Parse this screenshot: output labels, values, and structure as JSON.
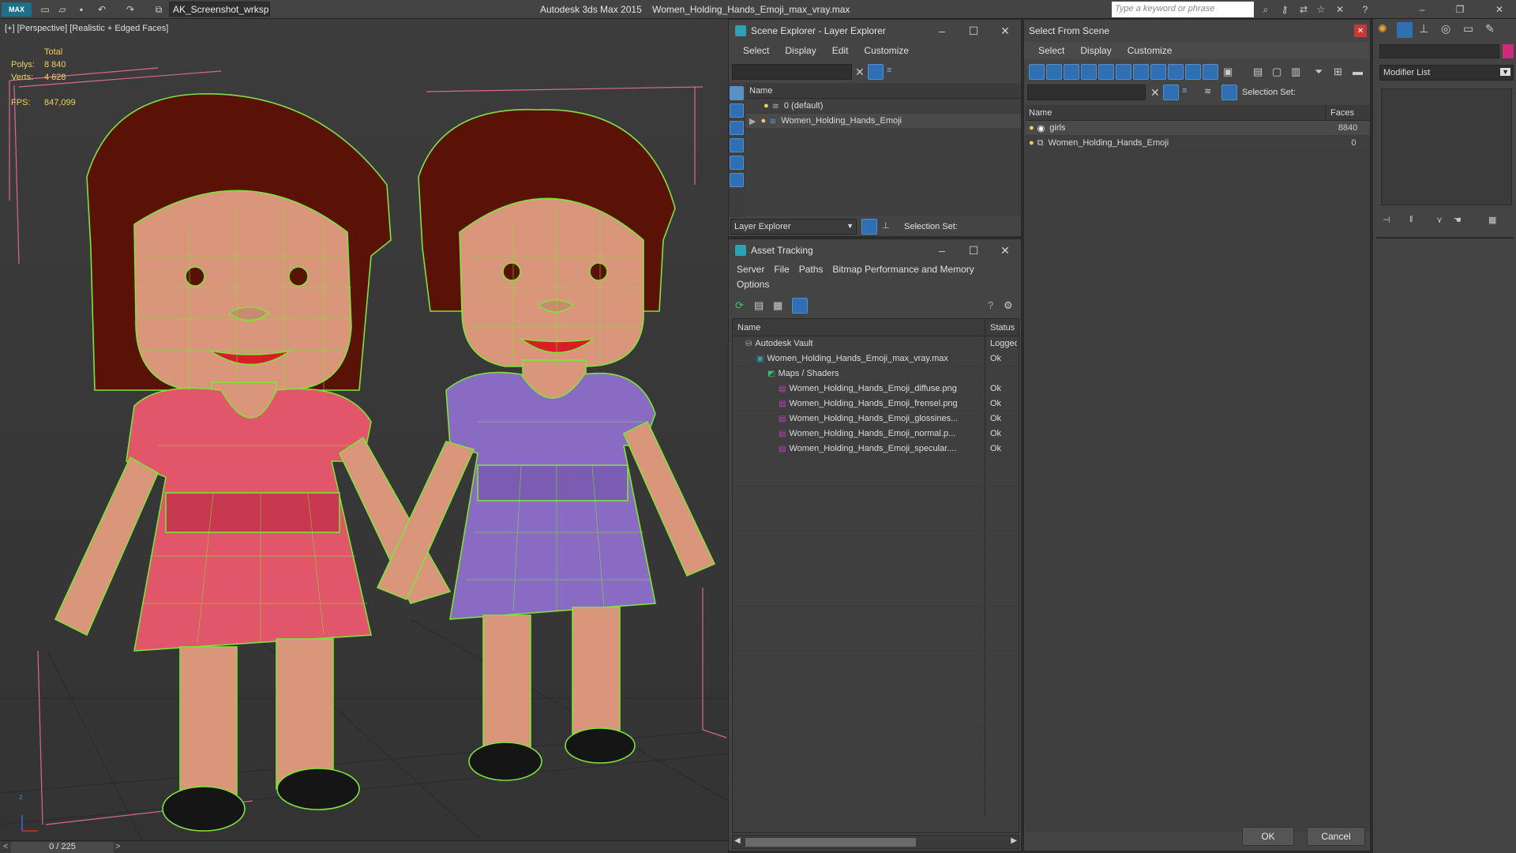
{
  "app": {
    "title": "Autodesk 3ds Max  2015",
    "file": "Women_Holding_Hands_Emoji_max_vray.max",
    "workspace": "AK_Screenshot_wrksp",
    "search_placeholder": "Type a keyword or phrase",
    "logo": "MAX"
  },
  "viewport": {
    "label": "[+] [Perspective] [Realistic + Edged Faces]",
    "stats_total": "Total",
    "polys_label": "Polys:",
    "polys_value": "8 840",
    "verts_label": "Verts:",
    "verts_value": "4 628",
    "fps_label": "FPS:",
    "fps_value": "847,099",
    "axis_z": "z",
    "timeline": "0 / 225"
  },
  "scene_explorer": {
    "title": "Scene Explorer - Layer Explorer",
    "menu": [
      "Select",
      "Display",
      "Edit",
      "Customize"
    ],
    "col_name": "Name",
    "rows": [
      "0 (default)",
      "Women_Holding_Hands_Emoji"
    ],
    "footer_dropdown": "Layer Explorer",
    "selection_set": "Selection Set:"
  },
  "asset_tracking": {
    "title": "Asset Tracking",
    "menu": [
      "Server",
      "File",
      "Paths",
      "Bitmap Performance and Memory"
    ],
    "menu2": "Options",
    "col_name": "Name",
    "col_status": "Status",
    "rows": [
      {
        "name": "Autodesk Vault",
        "status": "Logged",
        "indent": 0
      },
      {
        "name": "Women_Holding_Hands_Emoji_max_vray.max",
        "status": "Ok",
        "indent": 1
      },
      {
        "name": "Maps / Shaders",
        "status": "",
        "indent": 2
      },
      {
        "name": "Women_Holding_Hands_Emoji_diffuse.png",
        "status": "Ok",
        "indent": 3
      },
      {
        "name": "Women_Holding_Hands_Emoji_frensel.png",
        "status": "Ok",
        "indent": 3
      },
      {
        "name": "Women_Holding_Hands_Emoji_glossines...",
        "status": "Ok",
        "indent": 3
      },
      {
        "name": "Women_Holding_Hands_Emoji_normal.p...",
        "status": "Ok",
        "indent": 3
      },
      {
        "name": "Women_Holding_Hands_Emoji_specular....",
        "status": "Ok",
        "indent": 3
      }
    ]
  },
  "select_from_scene": {
    "title": "Select From Scene",
    "menu": [
      "Select",
      "Display",
      "Customize"
    ],
    "selection_set": "Selection Set:",
    "col_name": "Name",
    "col_faces": "Faces",
    "rows": [
      {
        "name": "girls",
        "faces": "8840"
      },
      {
        "name": "Women_Holding_Hands_Emoji",
        "faces": "0"
      }
    ],
    "ok": "OK",
    "cancel": "Cancel"
  },
  "command_panel": {
    "modifier_list": "Modifier List"
  },
  "colors": {
    "wire": "#7ee33a",
    "hair": "#5a1206",
    "skin": "#d9967a",
    "pink_dress": "#e2566a",
    "purple_dress": "#8a6bc4",
    "accent_blue": "#2f6fb3"
  }
}
